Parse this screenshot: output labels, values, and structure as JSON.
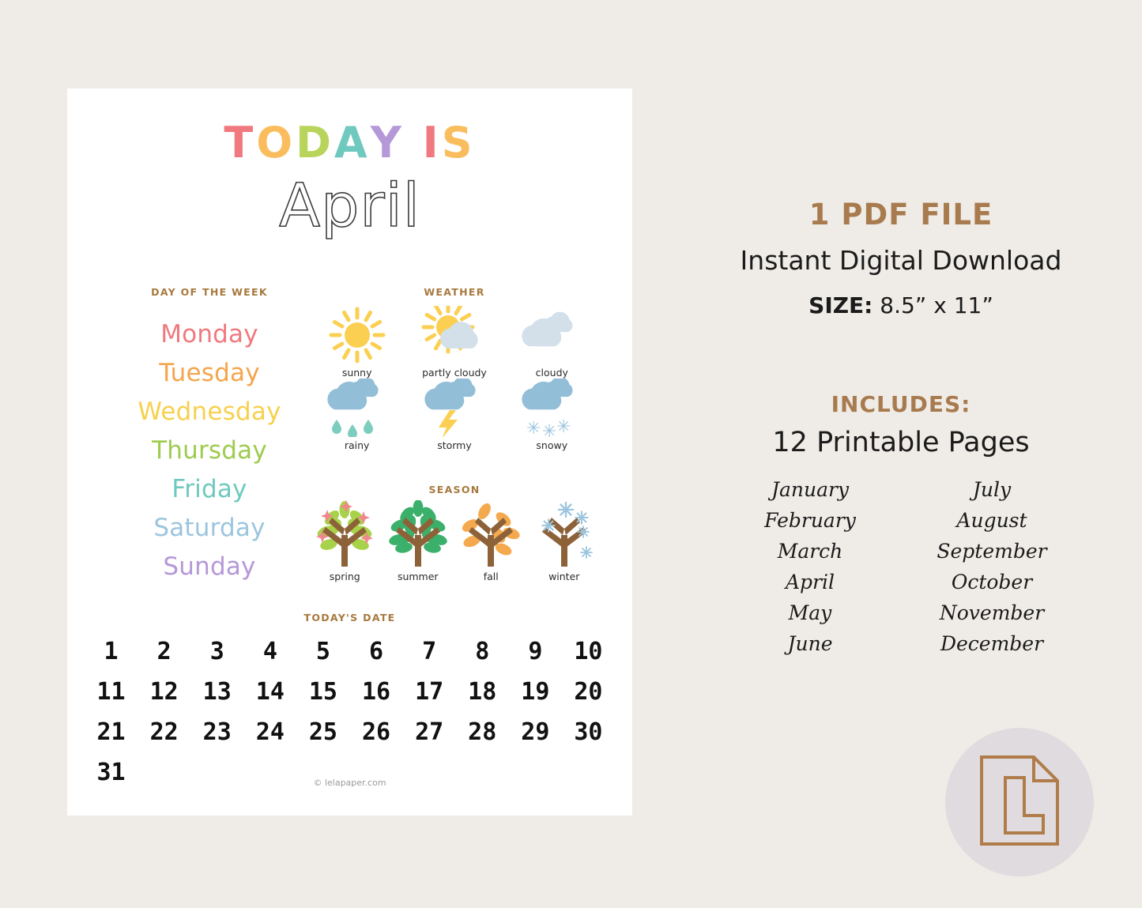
{
  "colors": {
    "page_background": "#efece7",
    "sheet_background": "#ffffff",
    "accent_brown": "#a87b4f",
    "badge_circle": "#e0dbdf",
    "sun_yellow": "#fbcf52",
    "cloud_blue": "#93bed8",
    "cloud_pale": "#d3e0ea",
    "raindrop_teal": "#7dcdbe",
    "snowflake_blue": "#9cc5de",
    "trunk_brown": "#8d6239",
    "spring_leaf": "#a8d24a",
    "spring_blossom": "#f2868f",
    "summer_leaf": "#3bb06a",
    "fall_leaf": "#f5a94e"
  },
  "printable": {
    "title_word": "TODAY IS",
    "title_letters": [
      {
        "ch": "T",
        "color": "#f0797f"
      },
      {
        "ch": "O",
        "color": "#f9bd5e"
      },
      {
        "ch": "D",
        "color": "#b8d45a"
      },
      {
        "ch": "A",
        "color": "#6fc9be"
      },
      {
        "ch": "Y",
        "color": "#b598d8"
      },
      {
        "ch": " ",
        "color": "#ffffff"
      },
      {
        "ch": "I",
        "color": "#f0797f"
      },
      {
        "ch": "S",
        "color": "#f9bd5e"
      }
    ],
    "month": "April",
    "day_of_week": {
      "heading": "DAY OF THE WEEK",
      "items": [
        {
          "label": "Monday",
          "color": "#f0797f"
        },
        {
          "label": "Tuesday",
          "color": "#f5a54b"
        },
        {
          "label": "Wednesday",
          "color": "#f7d04e"
        },
        {
          "label": "Thursday",
          "color": "#9ecb4e"
        },
        {
          "label": "Friday",
          "color": "#6fc9be"
        },
        {
          "label": "Saturday",
          "color": "#9cc5de"
        },
        {
          "label": "Sunday",
          "color": "#b598d8"
        }
      ]
    },
    "weather": {
      "heading": "WEATHER",
      "items": [
        {
          "label": "sunny",
          "icon": "sun-icon"
        },
        {
          "label": "partly cloudy",
          "icon": "sun-behind-cloud-icon"
        },
        {
          "label": "cloudy",
          "icon": "cloud-icon"
        },
        {
          "label": "rainy",
          "icon": "rain-cloud-icon"
        },
        {
          "label": "stormy",
          "icon": "storm-cloud-icon"
        },
        {
          "label": "snowy",
          "icon": "snow-cloud-icon"
        }
      ]
    },
    "season": {
      "heading": "SEASON",
      "items": [
        {
          "label": "spring",
          "icon": "spring-tree-icon"
        },
        {
          "label": "summer",
          "icon": "summer-tree-icon"
        },
        {
          "label": "fall",
          "icon": "fall-tree-icon"
        },
        {
          "label": "winter",
          "icon": "winter-tree-icon"
        }
      ]
    },
    "todays_date": {
      "heading": "TODAY'S DATE",
      "days": [
        1,
        2,
        3,
        4,
        5,
        6,
        7,
        8,
        9,
        10,
        11,
        12,
        13,
        14,
        15,
        16,
        17,
        18,
        19,
        20,
        21,
        22,
        23,
        24,
        25,
        26,
        27,
        28,
        29,
        30,
        31
      ]
    },
    "credit": "© lelapaper.com"
  },
  "info": {
    "pdf_file": "1 PDF FILE",
    "instant": "Instant Digital Download",
    "size_label": "SIZE:",
    "size_value": "8.5” x 11”",
    "includes": "INCLUDES:",
    "pages": "12 Printable Pages",
    "months": [
      "January",
      "July",
      "February",
      "August",
      "March",
      "September",
      "April",
      "October",
      "May",
      "November",
      "June",
      "December"
    ],
    "badge_icon": "document-file-icon"
  }
}
